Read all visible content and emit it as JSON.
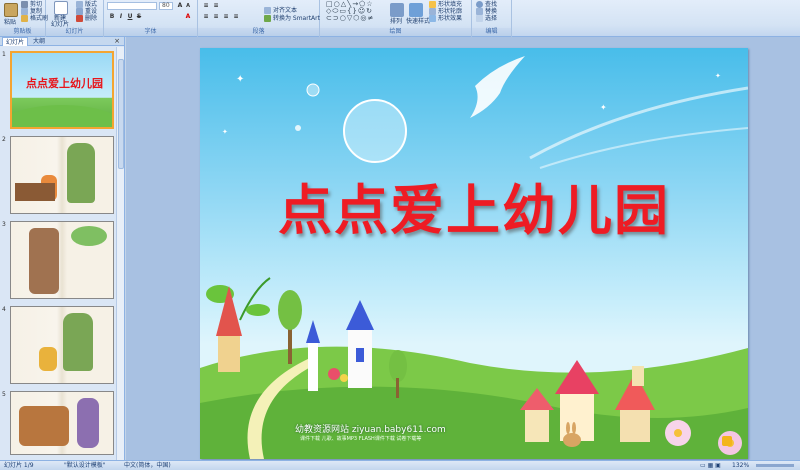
{
  "ribbon": {
    "clipboard": {
      "paste": "粘贴",
      "cut": "剪切",
      "copy": "复制",
      "format_painter": "格式刷",
      "label": "剪贴板"
    },
    "slides": {
      "new_slide": "新建",
      "new_slide_2": "幻灯片",
      "layout": "版式",
      "reset": "重设",
      "delete": "删除",
      "label": "幻灯片"
    },
    "font": {
      "font_name": "",
      "font_size": "80",
      "label": "字体"
    },
    "paragraph": {
      "align_text": "对齐文本",
      "convert_smartart": "转换为 SmartArt",
      "label": "段落"
    },
    "drawing": {
      "arrange": "排列",
      "quick_styles": "快速样式",
      "shape_fill": "形状填充",
      "shape_outline": "形状轮廓",
      "shape_effects": "形状效果",
      "label": "绘图"
    },
    "editing": {
      "find": "查找",
      "replace": "替换",
      "select": "选择",
      "label": "编辑"
    }
  },
  "pane": {
    "tab_slides": "幻灯片",
    "tab_outline": "大纲",
    "close": "×",
    "thumbnails": [
      {
        "num": "1",
        "title": "点点爱上幼儿园",
        "selected": true
      },
      {
        "num": "2",
        "selected": false
      },
      {
        "num": "3",
        "selected": false
      },
      {
        "num": "4",
        "selected": false
      },
      {
        "num": "5",
        "selected": false
      }
    ]
  },
  "slide": {
    "title": "点点爱上幼儿园",
    "website": "幼教资源网站  ziyuan.baby611.com",
    "website_sub": "课件下载  儿歌、故事MP3  FLASH课件下载  试卷下载等"
  },
  "status": {
    "slide_count": "幻灯片 1/9",
    "theme": "\"默认设计模板\"",
    "language": "中文(简体，中国)",
    "zoom": "132%"
  },
  "colors": {
    "title": "#ee1c24",
    "selection": "#f4a531",
    "ribbon": "#d4e3f4"
  }
}
